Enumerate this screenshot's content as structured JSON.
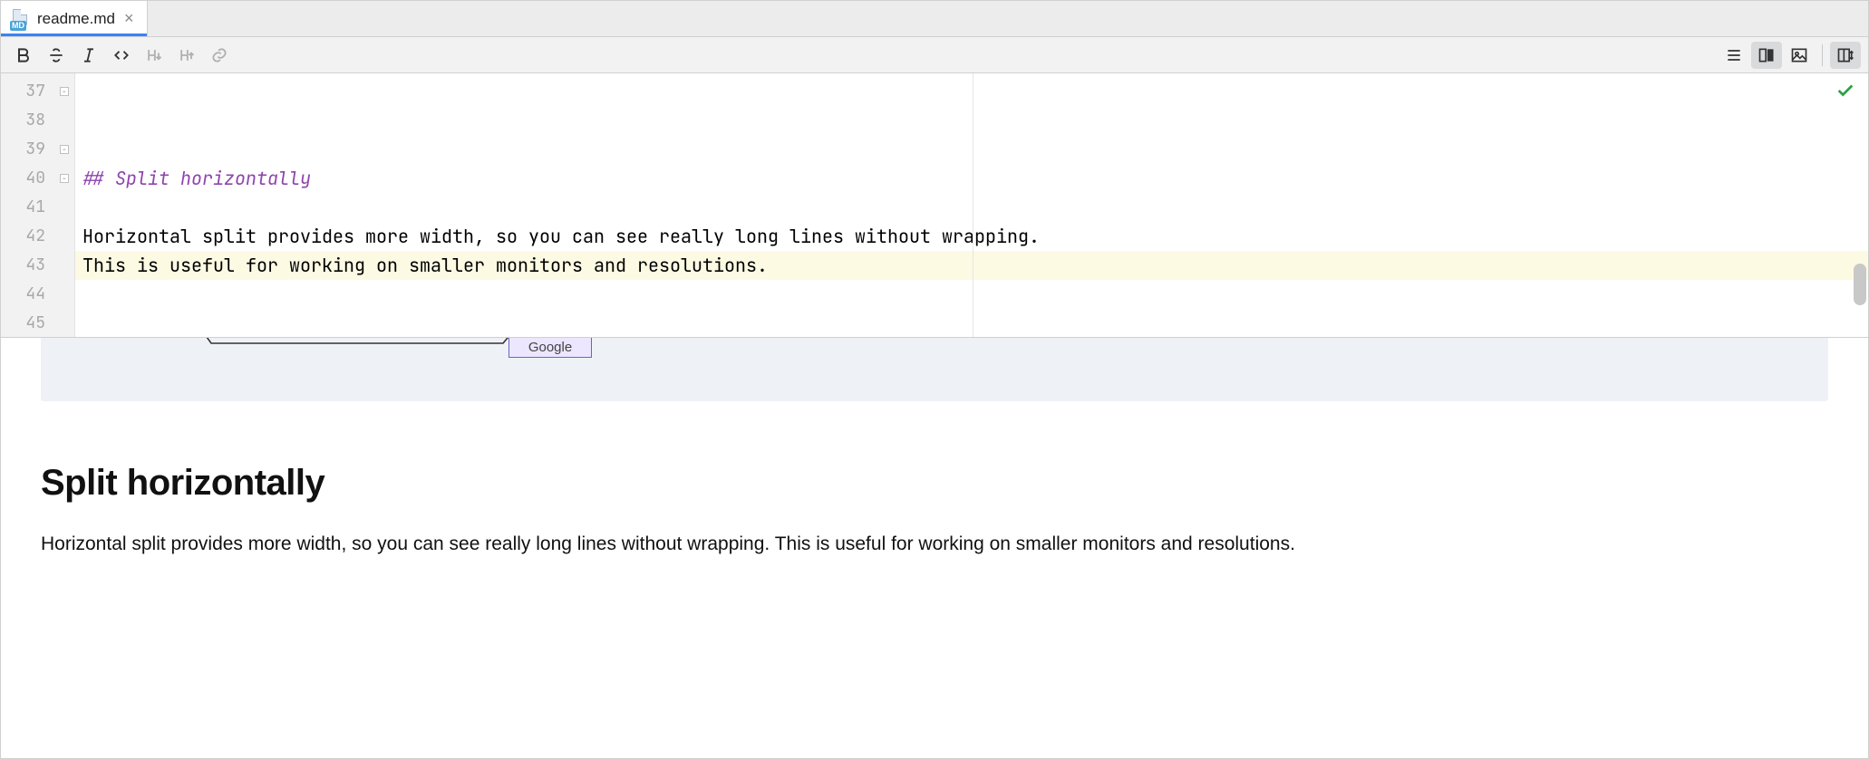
{
  "tab": {
    "filename": "readme.md",
    "icon_badge": "MD"
  },
  "toolbar": {
    "left": [
      "bold",
      "strikethrough",
      "italic",
      "code",
      "header-down",
      "header-up",
      "link"
    ],
    "right": [
      "table-of-contents",
      "editor-preview",
      "image",
      "split-layout"
    ]
  },
  "editor": {
    "line_start": 37,
    "line_count": 9,
    "highlighted_line": 40,
    "guide_column": 80,
    "lines": [
      {
        "n": 37,
        "fold": true,
        "kind": "heading",
        "text": "## Split horizontally"
      },
      {
        "n": 38,
        "fold": false,
        "kind": "plain",
        "text": ""
      },
      {
        "n": 39,
        "fold": true,
        "kind": "plain",
        "text": "Horizontal split provides more width, so you can see really long lines without wrapping."
      },
      {
        "n": 40,
        "fold": true,
        "kind": "plain",
        "text": "This is useful for working on smaller monitors and resolutions."
      },
      {
        "n": 41,
        "fold": false,
        "kind": "plain",
        "text": ""
      },
      {
        "n": 42,
        "fold": false,
        "kind": "plain",
        "text": ""
      },
      {
        "n": 43,
        "fold": false,
        "kind": "plain",
        "text": ""
      },
      {
        "n": 44,
        "fold": false,
        "kind": "plain",
        "text": ""
      },
      {
        "n": 45,
        "fold": false,
        "kind": "plain",
        "text": ""
      }
    ],
    "status": "ok"
  },
  "preview": {
    "diagram_node_label": "Google",
    "heading": "Split horizontally",
    "paragraph": "Horizontal split provides more width, so you can see really long lines without wrapping. This is useful for working on smaller monitors and resolutions."
  }
}
